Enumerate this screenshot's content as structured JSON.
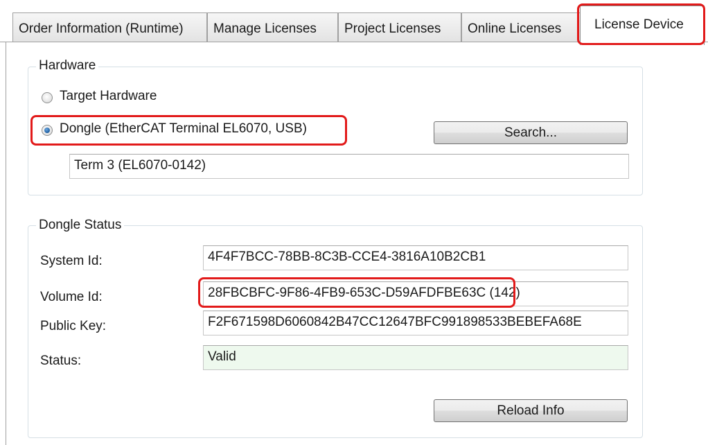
{
  "tabs": [
    {
      "label": "Order Information (Runtime)"
    },
    {
      "label": "Manage Licenses"
    },
    {
      "label": "Project Licenses"
    },
    {
      "label": "Online Licenses"
    },
    {
      "label": "License Device"
    }
  ],
  "active_tab": "License Device",
  "hardware": {
    "title": "Hardware",
    "options": [
      {
        "label": "Target Hardware",
        "checked": false
      },
      {
        "label": "Dongle (EtherCAT Terminal EL6070, USB)",
        "checked": true
      }
    ],
    "search_label": "Search...",
    "device_value": "Term 3 (EL6070-0142)"
  },
  "dongle_status": {
    "title": "Dongle Status",
    "rows": [
      {
        "label": "System Id:",
        "value": "4F4F7BCC-78BB-8C3B-CCE4-3816A10B2CB1"
      },
      {
        "label": "Volume Id:",
        "value": "28FBCBFC-9F86-4FB9-653C-D59AFDFBE63C (142)"
      },
      {
        "label": "Public Key:",
        "value": "F2F671598D6060842B47CC12647BFC991898533BEBEFA68E"
      },
      {
        "label": "Status:",
        "value": "Valid"
      }
    ],
    "reload_label": "Reload Info"
  },
  "colors": {
    "highlight": "#e21a1a",
    "valid_bg": "#eef9ee",
    "radio_fill": "#1d5d9f"
  }
}
